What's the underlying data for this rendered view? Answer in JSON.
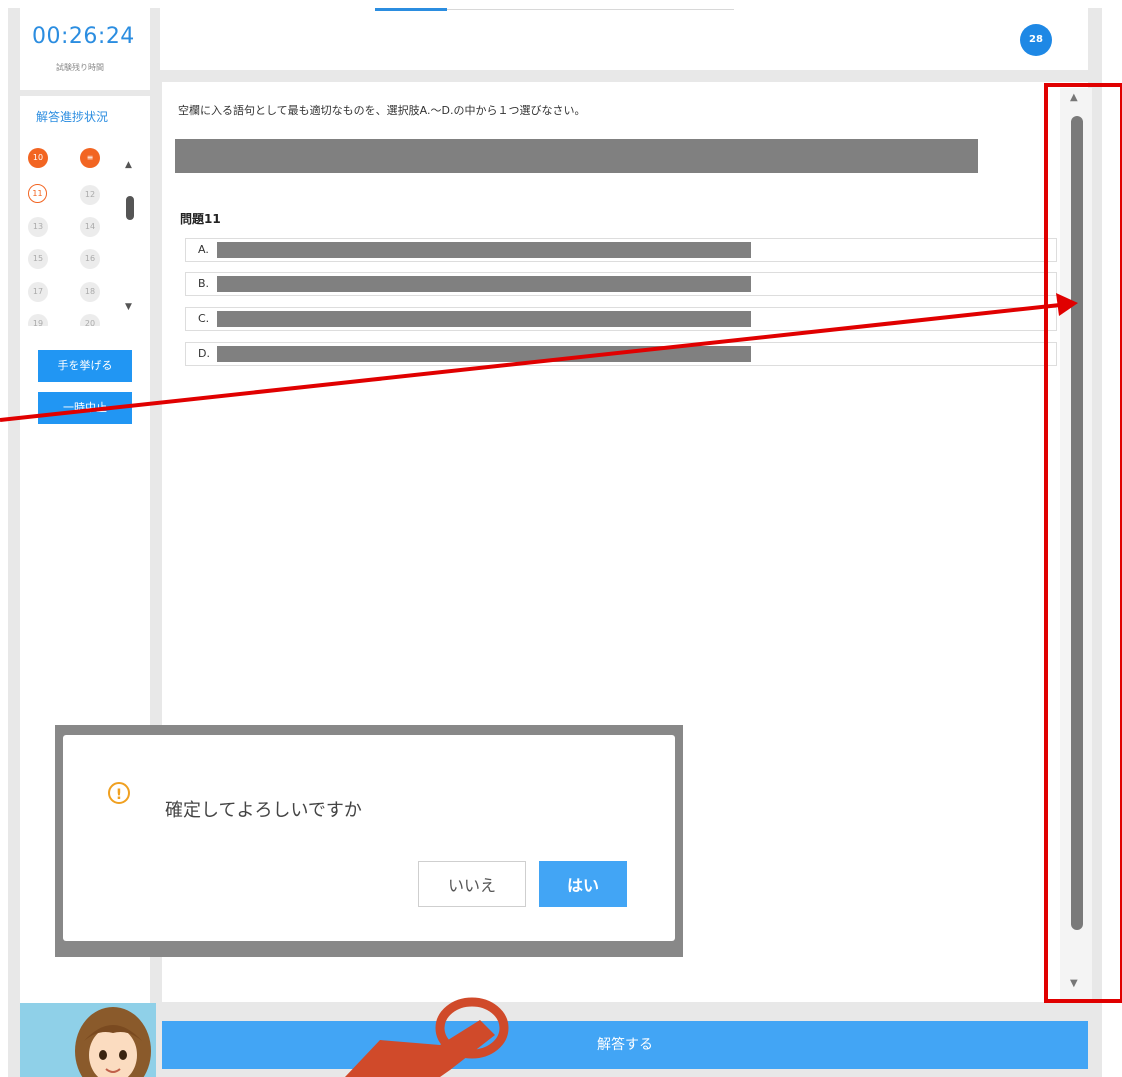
{
  "timer": {
    "value": "00:26:24",
    "label": "試験残り時間"
  },
  "progress": {
    "title": "解答進捗状況",
    "dots": [
      {
        "n": "10",
        "state": "done"
      },
      {
        "n": "≡",
        "state": "done"
      },
      {
        "n": "11",
        "state": "current"
      },
      {
        "n": "12",
        "state": "todo"
      },
      {
        "n": "13",
        "state": "todo"
      },
      {
        "n": "14",
        "state": "todo"
      },
      {
        "n": "15",
        "state": "todo"
      },
      {
        "n": "16",
        "state": "todo"
      },
      {
        "n": "17",
        "state": "todo"
      },
      {
        "n": "18",
        "state": "todo"
      },
      {
        "n": "19",
        "state": "todo"
      },
      {
        "n": "20",
        "state": "todo"
      }
    ]
  },
  "sidebar_buttons": {
    "raise_hand": "手を挙げる",
    "second": "一時中止"
  },
  "header": {
    "question_count": "28"
  },
  "question": {
    "instruction": "空欄に入る語句として最も適切なものを、選択肢A.～D.の中から１つ選びなさい。",
    "label": "問題11",
    "choices": [
      {
        "letter": "A."
      },
      {
        "letter": "B."
      },
      {
        "letter": "C."
      },
      {
        "letter": "D."
      }
    ]
  },
  "dialog": {
    "message": "確定してよろしいですか",
    "no_label": "いいえ",
    "yes_label": "はい"
  },
  "footer": {
    "submit_label": "解答する"
  },
  "annotation_color": "#e00000"
}
